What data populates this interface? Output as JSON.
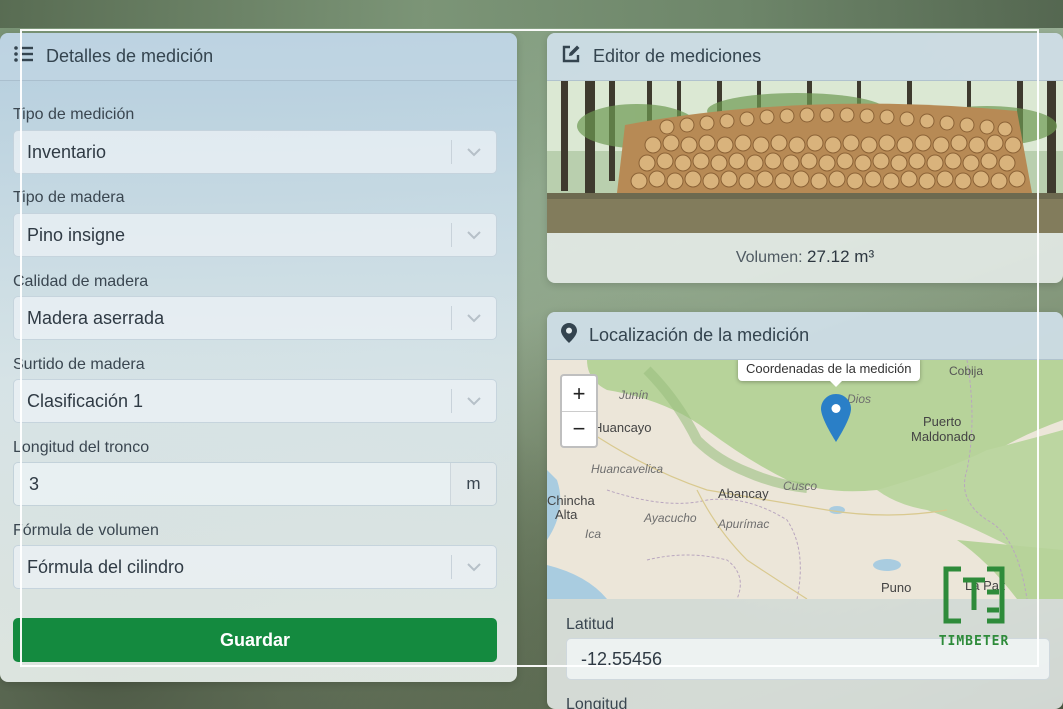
{
  "details": {
    "title": "Detalles de medición",
    "icon": "list-icon",
    "fields": [
      {
        "label": "Tipo de medición",
        "value": "Inventario"
      },
      {
        "label": "Tipo de madera",
        "value": "Pino insigne"
      },
      {
        "label": "Calidad de madera",
        "value": "Madera aserrada"
      },
      {
        "label": "Surtido de madera",
        "value": "Clasificación 1"
      }
    ],
    "length": {
      "label": "Longitud del tronco",
      "value": "3",
      "unit": "m"
    },
    "formula": {
      "label": "Fórmula de volumen",
      "value": "Fórmula del cilindro"
    },
    "save_label": "Guardar"
  },
  "editor": {
    "title": "Editor de mediciones",
    "icon": "edit-icon",
    "volume_label": "Volumen:",
    "volume_value": "27.12 m³"
  },
  "location": {
    "title": "Localización de la medición",
    "icon": "map-pin-icon",
    "tooltip": "Coordenadas de la medición",
    "zoom_in": "+",
    "zoom_out": "−",
    "map_labels": {
      "cobija": "Cobija",
      "junin": "Junín",
      "huancayo": "Huancayo",
      "dios": "Dios",
      "puerto": "Puerto",
      "maldonado": "Maldonado",
      "huancavelica": "Huancavelica",
      "abancay": "Abancay",
      "cusco": "Cusco",
      "chincha": "Chincha",
      "alta": "Alta",
      "ayacucho": "Ayacucho",
      "apurimac": "Apurímac",
      "ica": "Ica",
      "puno": "Puno",
      "la_paz": "La Paz"
    },
    "latitude_label": "Latitud",
    "latitude_value": "-12.55456",
    "longitude_label": "Longitud"
  },
  "brand": {
    "name": "TIMBETER",
    "color": "#2e8b3a"
  },
  "colors": {
    "primary_button": "#148a3f",
    "marker": "#2a7fc7"
  }
}
